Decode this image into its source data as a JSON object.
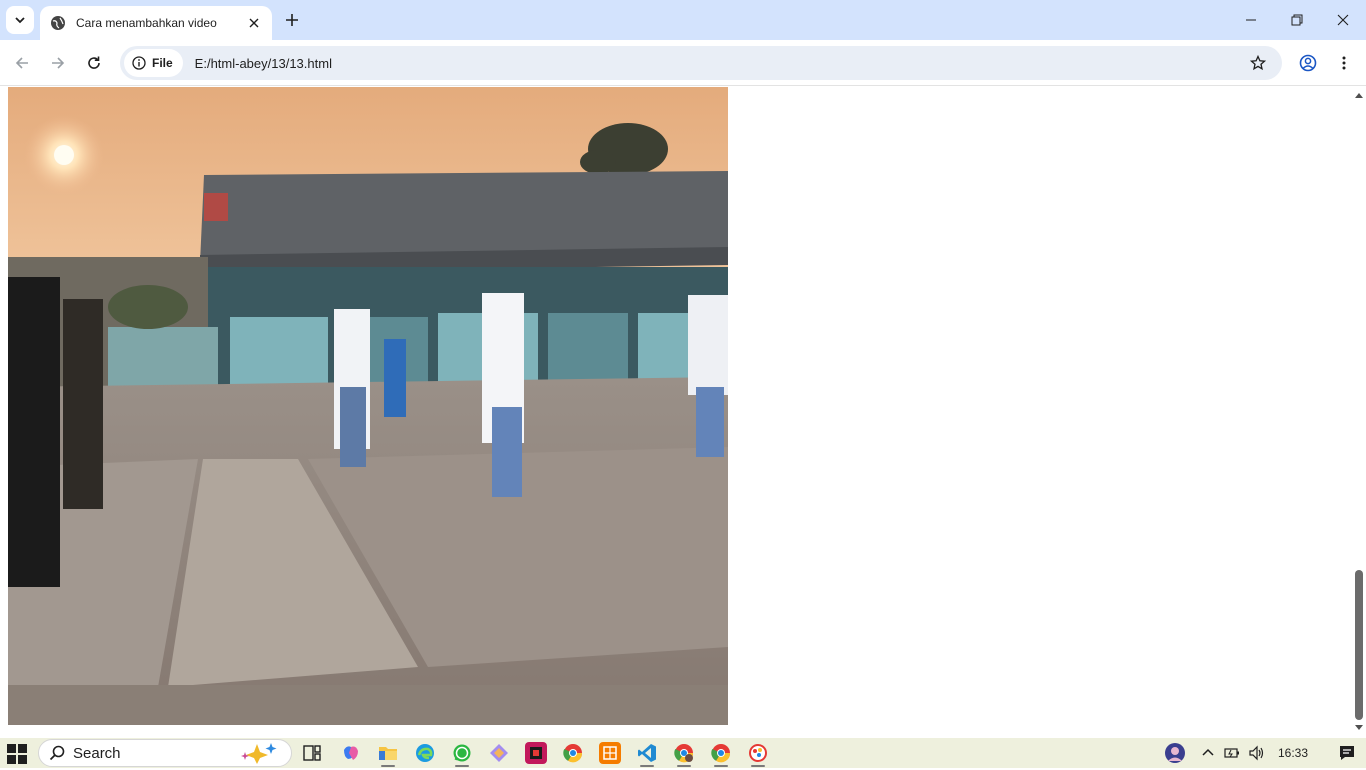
{
  "browser": {
    "tab_title": "Cara menambahkan video",
    "url_chip": "File",
    "url": "E:/html-abey/13/13.html"
  },
  "icons": {
    "tab_list": "chevron-down-icon",
    "favicon": "globe-icon",
    "tab_close": "close-icon",
    "new_tab": "plus-icon",
    "minimize": "minimize-icon",
    "maximize": "restore-icon",
    "close": "close-icon",
    "back": "arrow-left-icon",
    "forward": "arrow-right-icon",
    "reload": "reload-icon",
    "site_info": "info-icon",
    "bookmark": "star-icon",
    "profile": "profile-icon",
    "menu": "kebab-menu-icon"
  },
  "page": {
    "video_alt": "Video frame: students in white hijab uniforms standing in a schoolyard at sunset"
  },
  "taskbar": {
    "search_placeholder": "Search",
    "time": "16:33",
    "apps": [
      "task-view",
      "copilot",
      "file-explorer",
      "edge",
      "whatsapp",
      "app-gem",
      "app-red",
      "chrome",
      "app-orange",
      "vscode",
      "chrome-profile-2",
      "chrome-profile-3",
      "app-paint"
    ]
  },
  "colors": {
    "tabstrip": "#d3e3fd",
    "omnibox": "#e9eef6",
    "taskbar": "#eef0dd"
  }
}
